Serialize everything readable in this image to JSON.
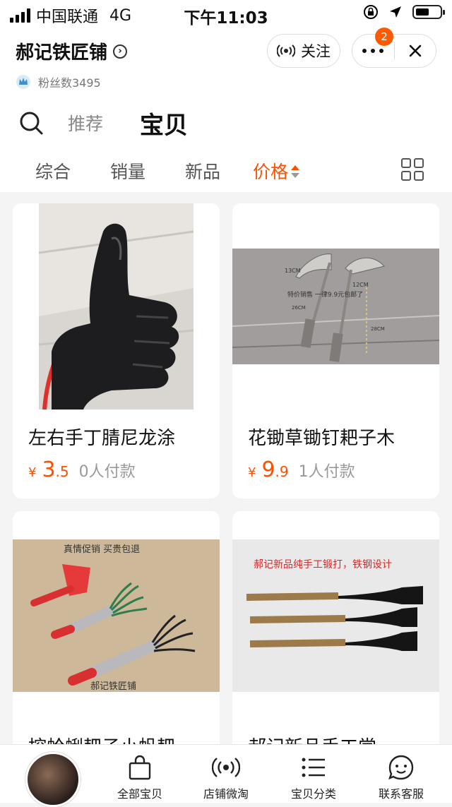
{
  "status_bar": {
    "carrier": "中国联通",
    "network": "4G",
    "time": "下午11:03",
    "battery_level": 0.55
  },
  "header": {
    "shop_name": "郝记铁匠铺",
    "follow_label": "关注",
    "more_badge": "2",
    "fans_label": "粉丝数3495"
  },
  "tabs": {
    "recommend": "推荐",
    "items": "宝贝"
  },
  "sort": {
    "general": "综合",
    "sales": "销量",
    "new": "新品",
    "price": "价格"
  },
  "products": [
    {
      "title": "左右手丁腈尼龙涂",
      "currency": "¥",
      "price_int": "3",
      "price_dec": ".5",
      "sales": "0人付款"
    },
    {
      "title": "花锄草锄钉耙子木",
      "currency": "¥",
      "price_int": "9",
      "price_dec": ".9",
      "sales": "1人付款",
      "image_text": [
        "13CM",
        "12CM",
        "特价销售   一律9.9元包邮了",
        "26CM",
        "28CM"
      ]
    },
    {
      "title": "挖蛤蜊耙子小帆耙",
      "image_text": [
        "真情促销   买贵包退",
        "郝记铁匠铺"
      ]
    },
    {
      "title": "郝记新品手工常",
      "image_text": [
        "郝记新品纯手工锻打，铁钢设计"
      ]
    }
  ],
  "bottom_nav": [
    {
      "label": "全部宝贝",
      "icon": "shopping-bag-icon"
    },
    {
      "label": "店铺微淘",
      "icon": "broadcast-icon"
    },
    {
      "label": "宝贝分类",
      "icon": "list-icon"
    },
    {
      "label": "联系客服",
      "icon": "chat-face-icon"
    }
  ],
  "colors": {
    "accent": "#ff5000",
    "badge": "#ff5a00"
  }
}
